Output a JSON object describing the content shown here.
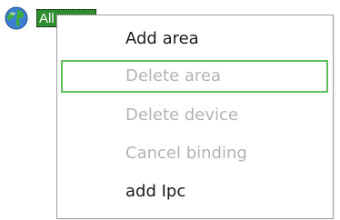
{
  "tree": {
    "node_icon": "globe-icon",
    "node_label": "All"
  },
  "context_menu": {
    "items": [
      {
        "label": "Add area",
        "enabled": true,
        "highlighted": false
      },
      {
        "label": "Delete area",
        "enabled": false,
        "highlighted": true
      },
      {
        "label": "Delete device",
        "enabled": false,
        "highlighted": false
      },
      {
        "label": "Cancel binding",
        "enabled": false,
        "highlighted": false
      },
      {
        "label": "add Ipc",
        "enabled": true,
        "highlighted": false
      }
    ]
  },
  "colors": {
    "node_label_bg": "#2e8b2e",
    "highlight_border": "#5fbf5f",
    "disabled_text": "#b3b3b3",
    "menu_border": "#9d9d9d"
  }
}
